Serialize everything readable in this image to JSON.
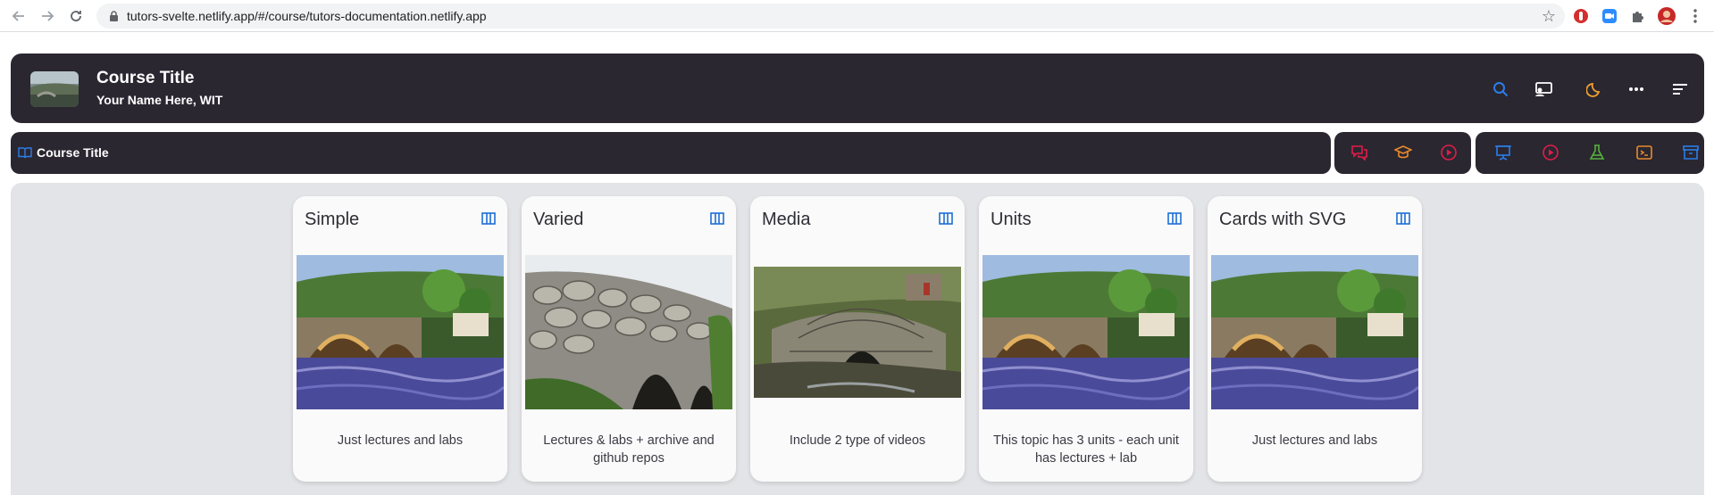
{
  "browser": {
    "url": "tutors-svelte.netlify.app/#/course/tutors-documentation.netlify.app",
    "icons": [
      "back-icon",
      "forward-icon",
      "reload-icon",
      "lock-icon",
      "bookmark-star-icon",
      "extension-icons",
      "profile-avatar",
      "menu-icon"
    ]
  },
  "header": {
    "title": "Course Title",
    "subtitle": "Your Name Here, WIT",
    "icons": [
      "search-icon",
      "tutors-live-icon",
      "dark-mode-icon",
      "more-icon",
      "toc-icon"
    ]
  },
  "breadcrumb": {
    "label": "Course Title",
    "icon": "book-icon"
  },
  "toolbar": {
    "group1": [
      "chat-icon",
      "graduation-icon",
      "video-icon"
    ],
    "group2": [
      "lecture-icon",
      "video-icon",
      "lab-icon",
      "terminal-icon",
      "archive-icon"
    ]
  },
  "colors": {
    "bar": "#2a2731",
    "accent_blue": "#1d6ed6",
    "red": "#e11d48",
    "orange": "#ea8a2a",
    "green": "#56b23a",
    "main_bg": "#e3e4e7"
  },
  "cards": [
    {
      "title": "Simple",
      "description": "Just lectures and labs",
      "image": "stone-bridge-village"
    },
    {
      "title": "Varied",
      "description": "Lectures & labs + archive and github repos",
      "image": "dry-stone-bridge"
    },
    {
      "title": "Media",
      "description": "Include 2 type of videos",
      "image": "small-stone-arch"
    },
    {
      "title": "Units",
      "description": "This topic has 3 units - each unit has lectures + lab",
      "image": "stone-bridge-village"
    },
    {
      "title": "Cards with SVG",
      "description": "Just lectures and labs",
      "image": "stone-bridge-village"
    }
  ]
}
